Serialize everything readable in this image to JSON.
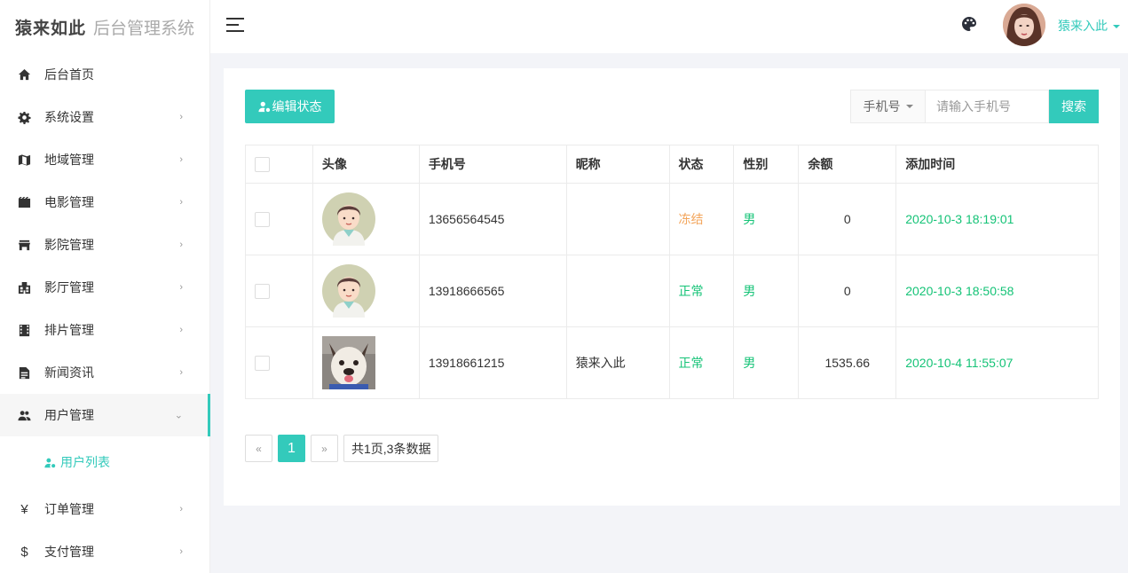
{
  "brand": {
    "logo": "猿来如此",
    "subtitle": "后台管理系统"
  },
  "sidebar": {
    "items": [
      {
        "label": "后台首页",
        "icon": "home-icon"
      },
      {
        "label": "系统设置",
        "icon": "gear-icon"
      },
      {
        "label": "地域管理",
        "icon": "map-icon"
      },
      {
        "label": "电影管理",
        "icon": "film-icon"
      },
      {
        "label": "影院管理",
        "icon": "store-icon"
      },
      {
        "label": "影厅管理",
        "icon": "building-icon"
      },
      {
        "label": "排片管理",
        "icon": "filmstrip-icon"
      },
      {
        "label": "新闻资讯",
        "icon": "news-icon"
      },
      {
        "label": "用户管理",
        "icon": "users-icon"
      },
      {
        "label": "订单管理",
        "icon": "yen-icon",
        "glyph": "¥"
      },
      {
        "label": "支付管理",
        "icon": "dollar-icon",
        "glyph": "$"
      }
    ],
    "sub_item": {
      "label": "用户列表",
      "icon": "user-settings-icon"
    }
  },
  "header": {
    "username": "猿来入此"
  },
  "toolbar": {
    "edit_label": "编辑状态",
    "search_field": "手机号",
    "search_placeholder": "请输入手机号",
    "search_button": "搜索"
  },
  "table": {
    "columns": [
      "头像",
      "手机号",
      "昵称",
      "状态",
      "性别",
      "余额",
      "添加时间"
    ],
    "rows": [
      {
        "phone": "13656564545",
        "nickname": "",
        "status": "冻结",
        "gender": "男",
        "balance": "0",
        "time": "2020-10-3 18:19:01"
      },
      {
        "phone": "13918666565",
        "nickname": "",
        "status": "正常",
        "gender": "男",
        "balance": "0",
        "time": "2020-10-3 18:50:58"
      },
      {
        "phone": "13918661215",
        "nickname": "猿来入此",
        "status": "正常",
        "gender": "男",
        "balance": "1535.66",
        "time": "2020-10-4 11:55:07"
      }
    ]
  },
  "pagination": {
    "prev": "«",
    "current": "1",
    "next": "»",
    "info": "共1页,3条数据"
  },
  "colors": {
    "accent": "#33cabb",
    "success": "#15c377",
    "warning": "#f3a55b"
  }
}
